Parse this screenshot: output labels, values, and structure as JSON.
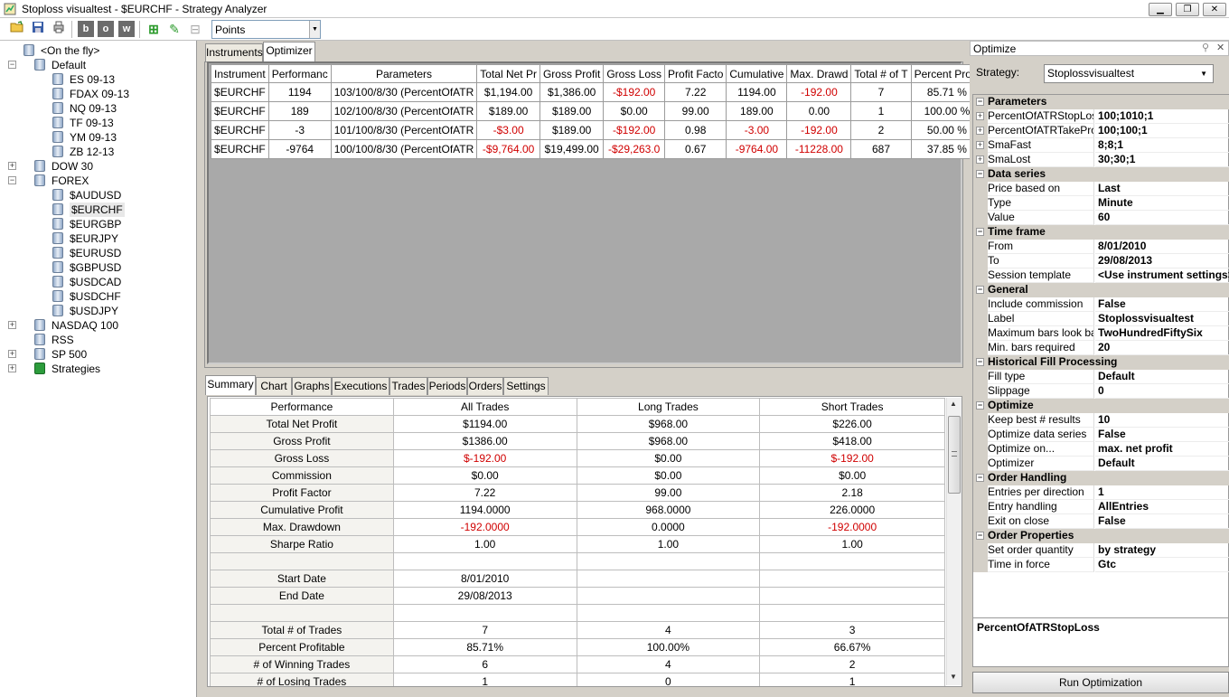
{
  "window": {
    "title": "Stoploss visualtest - $EURCHF - Strategy Analyzer"
  },
  "toolbar": {
    "display_combo": "Points"
  },
  "tree": [
    {
      "label": "<On the fly>",
      "level": 1,
      "exp": ""
    },
    {
      "label": "Default",
      "level": 0,
      "exp": "−"
    },
    {
      "label": "ES 09-13",
      "level": 2,
      "exp": ""
    },
    {
      "label": "FDAX 09-13",
      "level": 2,
      "exp": ""
    },
    {
      "label": "NQ 09-13",
      "level": 2,
      "exp": ""
    },
    {
      "label": "TF 09-13",
      "level": 2,
      "exp": ""
    },
    {
      "label": "YM 09-13",
      "level": 2,
      "exp": ""
    },
    {
      "label": "ZB 12-13",
      "level": 2,
      "exp": ""
    },
    {
      "label": "DOW 30",
      "level": 0,
      "exp": "+"
    },
    {
      "label": "FOREX",
      "level": 0,
      "exp": "−"
    },
    {
      "label": "$AUDUSD",
      "level": 2,
      "exp": ""
    },
    {
      "label": "$EURCHF",
      "level": 2,
      "exp": ""
    },
    {
      "label": "$EURGBP",
      "level": 2,
      "exp": ""
    },
    {
      "label": "$EURJPY",
      "level": 2,
      "exp": ""
    },
    {
      "label": "$EURUSD",
      "level": 2,
      "exp": ""
    },
    {
      "label": "$GBPUSD",
      "level": 2,
      "exp": ""
    },
    {
      "label": "$USDCAD",
      "level": 2,
      "exp": ""
    },
    {
      "label": "$USDCHF",
      "level": 2,
      "exp": ""
    },
    {
      "label": "$USDJPY",
      "level": 2,
      "exp": ""
    },
    {
      "label": "NASDAQ 100",
      "level": 0,
      "exp": "+"
    },
    {
      "label": "RSS",
      "level": 0,
      "exp": ""
    },
    {
      "label": "SP 500",
      "level": 0,
      "exp": "+"
    },
    {
      "label": "Strategies",
      "level": 0,
      "exp": "+"
    }
  ],
  "top_tabs": [
    "Instruments",
    "Optimizer"
  ],
  "optimizer": {
    "columns": [
      "Instrument",
      "Performanc",
      "Parameters",
      "Total Net Pr",
      "Gross Profit",
      "Gross Loss",
      "Profit Facto",
      "Cumulative",
      "Max. Drawd",
      "Total # of T",
      "Percent Profit"
    ],
    "rows": [
      [
        "$EURCHF",
        "1194",
        "103/100/8/30 (PercentOfATR",
        "$1,194.00",
        "$1,386.00",
        "-$192.00",
        "7.22",
        "1194.00",
        "-192.00",
        "7",
        "85.71 %"
      ],
      [
        "$EURCHF",
        "189",
        "102/100/8/30 (PercentOfATR",
        "$189.00",
        "$189.00",
        "$0.00",
        "99.00",
        "189.00",
        "0.00",
        "1",
        "100.00 %"
      ],
      [
        "$EURCHF",
        "-3",
        "101/100/8/30 (PercentOfATR",
        "-$3.00",
        "$189.00",
        "-$192.00",
        "0.98",
        "-3.00",
        "-192.00",
        "2",
        "50.00 %"
      ],
      [
        "$EURCHF",
        "-9764",
        "100/100/8/30 (PercentOfATR",
        "-$9,764.00",
        "$19,499.00",
        "-$29,263.0",
        "0.67",
        "-9764.00",
        "-11228.00",
        "687",
        "37.85 %"
      ]
    ]
  },
  "bottom_tabs": [
    "Summary",
    "Chart",
    "Graphs",
    "Executions",
    "Trades",
    "Periods",
    "Orders",
    "Settings"
  ],
  "summary": {
    "columns": [
      "Performance",
      "All Trades",
      "Long Trades",
      "Short Trades"
    ],
    "rows": [
      [
        "Total Net Profit",
        "$1194.00",
        "$968.00",
        "$226.00"
      ],
      [
        "Gross Profit",
        "$1386.00",
        "$968.00",
        "$418.00"
      ],
      [
        "Gross Loss",
        "$-192.00",
        "$0.00",
        "$-192.00"
      ],
      [
        "Commission",
        "$0.00",
        "$0.00",
        "$0.00"
      ],
      [
        "Profit Factor",
        "7.22",
        "99.00",
        "2.18"
      ],
      [
        "Cumulative Profit",
        "1194.0000",
        "968.0000",
        "226.0000"
      ],
      [
        "Max. Drawdown",
        "-192.0000",
        "0.0000",
        "-192.0000"
      ],
      [
        "Sharpe Ratio",
        "1.00",
        "1.00",
        "1.00"
      ],
      [
        "",
        "",
        "",
        ""
      ],
      [
        "Start Date",
        "8/01/2010",
        "",
        ""
      ],
      [
        "End Date",
        "29/08/2013",
        "",
        ""
      ],
      [
        "",
        "",
        "",
        ""
      ],
      [
        "Total # of Trades",
        "7",
        "4",
        "3"
      ],
      [
        "Percent Profitable",
        "85.71%",
        "100.00%",
        "66.67%"
      ],
      [
        "# of Winning Trades",
        "6",
        "4",
        "2"
      ],
      [
        "# of Losing Trades",
        "1",
        "0",
        "1"
      ]
    ]
  },
  "optimize_panel": {
    "header": "Optimize",
    "strategy_label": "Strategy:",
    "strategy_value": "Stoplossvisualtest",
    "properties": [
      {
        "cat": "Parameters"
      },
      {
        "k": "PercentOfATRStopLoss",
        "v": "100;1010;1",
        "exp": "+"
      },
      {
        "k": "PercentOfATRTakeProf",
        "v": "100;100;1",
        "exp": "+"
      },
      {
        "k": "SmaFast",
        "v": "8;8;1",
        "exp": "+"
      },
      {
        "k": "SmaLost",
        "v": "30;30;1",
        "exp": "+"
      },
      {
        "cat": "Data series"
      },
      {
        "k": "Price based on",
        "v": "Last"
      },
      {
        "k": "Type",
        "v": "Minute"
      },
      {
        "k": "Value",
        "v": "60"
      },
      {
        "cat": "Time frame"
      },
      {
        "k": "From",
        "v": "8/01/2010"
      },
      {
        "k": "To",
        "v": "29/08/2013"
      },
      {
        "k": "Session template",
        "v": "<Use instrument settings>"
      },
      {
        "cat": "General"
      },
      {
        "k": "Include commission",
        "v": "False"
      },
      {
        "k": "Label",
        "v": "Stoplossvisualtest"
      },
      {
        "k": "Maximum bars look back",
        "v": "TwoHundredFiftySix"
      },
      {
        "k": "Min. bars required",
        "v": "20"
      },
      {
        "cat": "Historical Fill Processing"
      },
      {
        "k": "Fill type",
        "v": "Default"
      },
      {
        "k": "Slippage",
        "v": "0"
      },
      {
        "cat": "Optimize"
      },
      {
        "k": "Keep best # results",
        "v": "10"
      },
      {
        "k": "Optimize data series",
        "v": "False"
      },
      {
        "k": "Optimize on...",
        "v": "max. net profit"
      },
      {
        "k": "Optimizer",
        "v": "Default"
      },
      {
        "cat": "Order Handling"
      },
      {
        "k": "Entries per direction",
        "v": "1"
      },
      {
        "k": "Entry handling",
        "v": "AllEntries"
      },
      {
        "k": "Exit on close",
        "v": "False"
      },
      {
        "cat": "Order Properties"
      },
      {
        "k": "Set order quantity",
        "v": "by strategy"
      },
      {
        "k": "Time in force",
        "v": "Gtc"
      }
    ],
    "description": "PercentOfATRStopLoss",
    "run_button": "Run Optimization"
  }
}
